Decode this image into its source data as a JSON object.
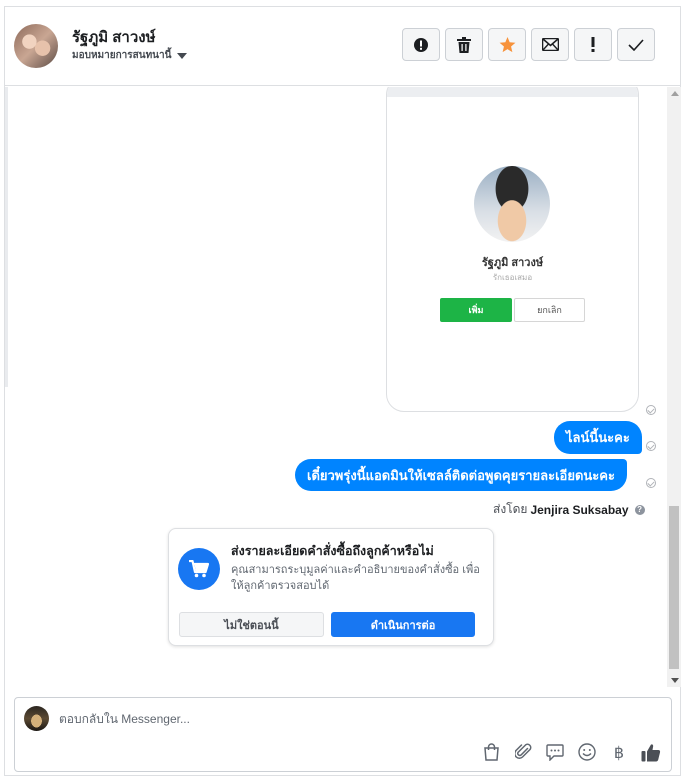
{
  "header": {
    "contact_name": "รัฐภูมิ สาวงษ์",
    "assign_label": "มอบหมายการสนทนานี้",
    "actions": [
      {
        "name": "mark-spam-icon"
      },
      {
        "name": "trash-icon"
      },
      {
        "name": "star-icon"
      },
      {
        "name": "envelope-icon"
      },
      {
        "name": "follow-up-icon"
      },
      {
        "name": "done-check-icon"
      }
    ]
  },
  "thread": {
    "shared_card": {
      "profile_name": "รัฐภูมิ สาวงษ์",
      "profile_subtitle": "รักเธอเสมอ",
      "add_label": "เพิ่ม",
      "cancel_label": "ยกเลิก"
    },
    "messages": [
      {
        "text": "ไลน์นี้นะคะ"
      },
      {
        "text": "เดี๋ยวพรุ่งนี้แอดมินให้เซลล์ติดต่อพูดคุยรายละเอียดนะคะ"
      }
    ],
    "sent_by_prefix": "ส่งโดย",
    "sent_by_name": "Jenjira Suksabay",
    "help_glyph": "?"
  },
  "order_prompt": {
    "title": "ส่งรายละเอียดคำสั่งซื้อถึงลูกค้าหรือไม่",
    "description": "คุณสามารถระบุมูลค่าและคำอธิบายของคำสั่งซื้อ เพื่อให้ลูกค้าตรวจสอบได้",
    "not_now_label": "ไม่ใช่ตอนนี้",
    "continue_label": "ดำเนินการต่อ"
  },
  "composer": {
    "placeholder": "ตอบกลับใน Messenger...",
    "tools": [
      "shopping-bag-icon",
      "attachment-icon",
      "saved-reply-icon",
      "emoji-icon",
      "baht-icon",
      "like-icon"
    ],
    "baht_glyph": "฿"
  },
  "colors": {
    "accent": "#1877f2",
    "bubble": "#0084ff",
    "line_green": "#1db446",
    "star": "#f7923b"
  }
}
